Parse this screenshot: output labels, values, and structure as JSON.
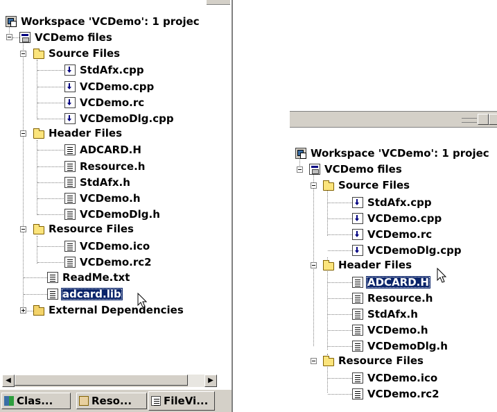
{
  "left": {
    "tree": {
      "workspace": "Workspace 'VCDemo': 1 projec",
      "project": "VCDemo files",
      "source_folder": "Source Files",
      "source_files": [
        "StdAfx.cpp",
        "VCDemo.cpp",
        "VCDemo.rc",
        "VCDemoDlg.cpp"
      ],
      "header_folder": "Header Files",
      "header_files": [
        "ADCARD.H",
        "Resource.h",
        "StdAfx.h",
        "VCDemo.h",
        "VCDemoDlg.h"
      ],
      "resource_folder": "Resource Files",
      "resource_files": [
        "VCDemo.ico",
        "VCDemo.rc2"
      ],
      "readme": "ReadMe.txt",
      "adcard_lib": "adcard.lib",
      "external": "External Dependencies"
    },
    "scroll": {
      "left_arrow": "◀",
      "right_arrow": "▶"
    },
    "tabs": [
      "Clas...",
      "Reso...",
      "FileVi..."
    ]
  },
  "right": {
    "tree": {
      "workspace": "Workspace 'VCDemo': 1 projec",
      "project": "VCDemo files",
      "source_folder": "Source Files",
      "source_files": [
        "StdAfx.cpp",
        "VCDemo.cpp",
        "VCDemo.rc",
        "VCDemoDlg.cpp"
      ],
      "header_folder": "Header Files",
      "header_files": [
        "ADCARD.H",
        "Resource.h",
        "StdAfx.h",
        "VCDemo.h",
        "VCDemoDlg.h"
      ],
      "resource_folder": "Resource Files",
      "resource_files": [
        "VCDemo.ico",
        "VCDemo.rc2"
      ]
    }
  },
  "colors": {
    "selection": "#0a246a",
    "chrome": "#d4d0c8",
    "folder": "#fbe47c"
  }
}
